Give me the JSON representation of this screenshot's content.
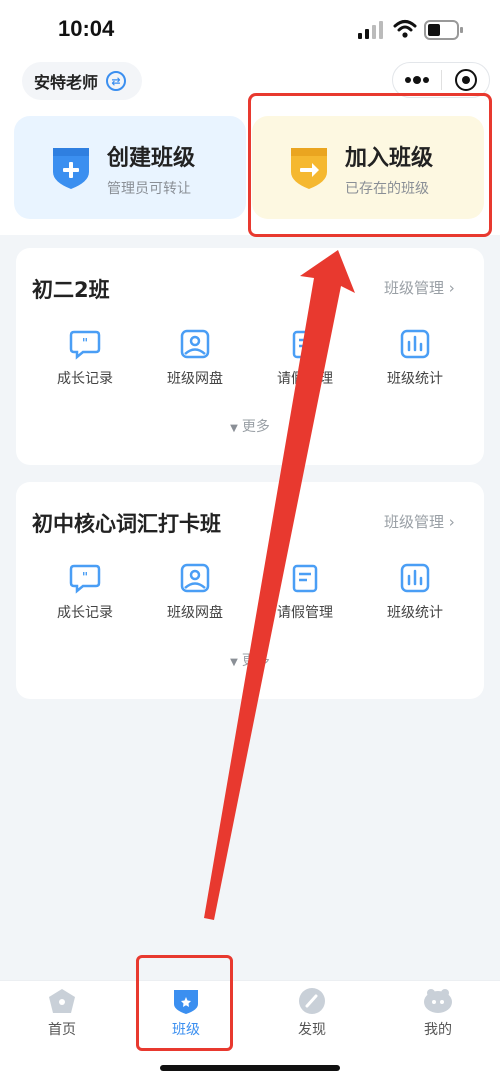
{
  "status_bar": {
    "time": "10:04"
  },
  "header": {
    "teacher_name": "安特老师"
  },
  "actions": {
    "create": {
      "title": "创建班级",
      "subtitle": "管理员可转让",
      "color": "#3b8ff0"
    },
    "join": {
      "title": "加入班级",
      "subtitle": "已存在的班级",
      "color": "#f5b830"
    }
  },
  "classes": [
    {
      "name": "初二2班",
      "manage_label": "班级管理",
      "features": [
        {
          "label": "成长记录",
          "icon": "chat-bubble-icon"
        },
        {
          "label": "班级网盘",
          "icon": "image-icon"
        },
        {
          "label": "请假管理",
          "icon": "leave-icon"
        },
        {
          "label": "班级统计",
          "icon": "bar-chart-icon"
        }
      ],
      "more_label": "更多"
    },
    {
      "name": "初中核心词汇打卡班",
      "manage_label": "班级管理",
      "features": [
        {
          "label": "成长记录",
          "icon": "chat-bubble-icon"
        },
        {
          "label": "班级网盘",
          "icon": "image-icon"
        },
        {
          "label": "请假管理",
          "icon": "leave-icon"
        },
        {
          "label": "班级统计",
          "icon": "bar-chart-icon"
        }
      ],
      "more_label": "更多"
    }
  ],
  "tabs": [
    {
      "label": "首页",
      "icon": "home-icon"
    },
    {
      "label": "班级",
      "icon": "class-icon",
      "active": true
    },
    {
      "label": "发现",
      "icon": "discover-icon"
    },
    {
      "label": "我的",
      "icon": "profile-icon"
    }
  ],
  "colors": {
    "accent": "#3b8ff0",
    "annotation": "#e8392f",
    "icon_blue": "#4a9ef5"
  }
}
